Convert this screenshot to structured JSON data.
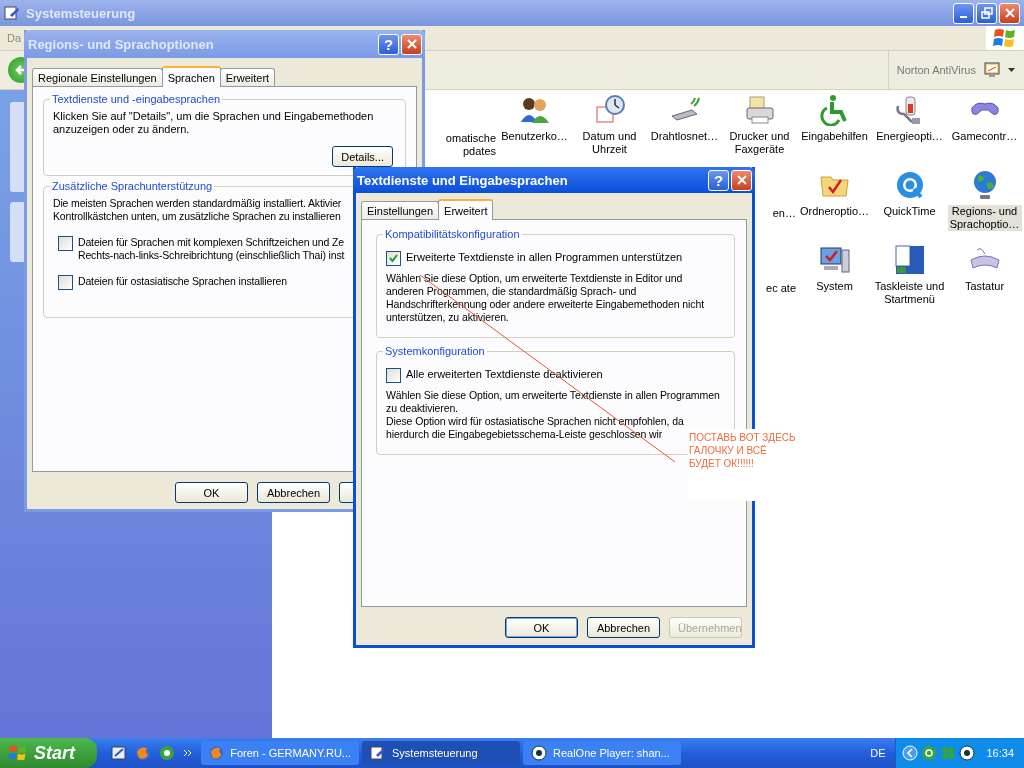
{
  "window": {
    "title": "Systemsteuerung",
    "menu": [
      "Da"
    ],
    "toolbar_label": "Norton AntiVirus"
  },
  "items": [
    [
      {
        "label": "omatische pdates",
        "kind": "cut",
        "selected": false
      },
      {
        "label": "Benutzerko…",
        "kind": "full",
        "selected": false
      },
      {
        "label": "Datum und Uhrzeit",
        "kind": "full",
        "selected": false
      },
      {
        "label": "Drahtlosnet…",
        "kind": "full",
        "selected": false
      },
      {
        "label": "Drucker und Faxgeräte",
        "kind": "full",
        "selected": false
      },
      {
        "label": "Eingabehilfen",
        "kind": "full",
        "selected": false
      },
      {
        "label": "Energieopti…",
        "kind": "full",
        "selected": false
      },
      {
        "label": "Gamecontr…",
        "kind": "full",
        "selected": false
      }
    ],
    [
      {
        "label": "en…",
        "kind": "cut",
        "selected": false
      },
      {
        "label": "Ordneroptio…",
        "kind": "full",
        "selected": false
      },
      {
        "label": "QuickTime",
        "kind": "full",
        "selected": false
      },
      {
        "label": "Regions- und Sprachoptio…",
        "kind": "full",
        "selected": true
      }
    ],
    [
      {
        "label": "ec ate",
        "kind": "cut",
        "selected": false
      },
      {
        "label": "System",
        "kind": "full",
        "selected": false
      },
      {
        "label": "Taskleiste und Startmenü",
        "kind": "full",
        "selected": false
      },
      {
        "label": "Tastatur",
        "kind": "full",
        "selected": false
      }
    ]
  ],
  "dialog_regions": {
    "title": "Regions- und Sprachoptionen",
    "help": "?",
    "tabs": [
      {
        "label": "Regionale Einstellungen",
        "selected": false
      },
      {
        "label": "Sprachen",
        "selected": true
      },
      {
        "label": "Erweitert",
        "selected": false
      }
    ],
    "group_1": {
      "title": "Textdienste und -eingabesprachen",
      "text": "Klicken Sie auf \"Details\", um die Sprachen und Eingabemethoden anzuzeigen oder zu ändern.",
      "button": "Details..."
    },
    "group_2": {
      "title": "Zusätzliche Sprachunterstützung",
      "lines": [
        "Die meisten Sprachen werden standardmäßig installiert. Aktivier",
        "Kontrollkästchen unten, um zusätzliche Sprachen zu installieren"
      ],
      "options": [
        {
          "lines": [
            "Dateien für Sprachen mit komplexen Schriftzeichen und Ze",
            "Rechts-nach-links-Schreibrichtung (einschließlich Thai) inst"
          ],
          "checked": false
        },
        {
          "lines": [
            "Dateien für ostasiatische Sprachen installieren"
          ],
          "checked": false
        }
      ]
    },
    "buttons": [
      "OK",
      "Abbrechen"
    ]
  },
  "dialog_text": {
    "title": "Textdienste und Eingabesprachen",
    "help": "?",
    "tabs": [
      {
        "label": "Einstellungen",
        "selected": false
      },
      {
        "label": "Erweitert",
        "selected": true
      }
    ],
    "groups": [
      {
        "title": "Kompatibilitätskonfiguration",
        "option": "Erweiterte Textdienste in allen Programmen unterstützen",
        "checked": true,
        "texts": [
          "Wählen Sie diese Option, um erweiterte Textdienste in Editor und anderen Programmen, die standardmäßig Sprach- und Handschrifterkennung oder andere erweiterte Eingabemethoden nicht unterstützen, zu aktivieren."
        ]
      },
      {
        "title": "Systemkonfiguration",
        "option": "Alle erweiterten Textdienste deaktivieren",
        "checked": false,
        "texts": [
          "Wählen Sie diese Option, um erweiterte Textdienste in allen Programmen zu deaktivieren.",
          "Diese Option wird für ostasiatische Sprachen nicht empfohlen, da hierdurch die Eingabegebietsschema-Leiste geschlossen wir"
        ]
      }
    ],
    "buttons": [
      {
        "label": "OK",
        "disabled": false
      },
      {
        "label": "Abbrechen",
        "disabled": false
      },
      {
        "label": "Übernehmen",
        "disabled": true
      }
    ]
  },
  "annotation": {
    "lines": [
      "ПОСТАВЬ ВОТ ЗДЕСЬ",
      "ГАЛОЧКУ И ВСЁ",
      "БУДЕТ ОК!!!!!!"
    ]
  },
  "taskbar": {
    "start": "Start",
    "tasks": [
      {
        "label": "Foren - GERMANY.RU...",
        "selected": false
      },
      {
        "label": "Systemsteuerung",
        "selected": true
      },
      {
        "label": "RealOne Player: shan...",
        "selected": false
      }
    ],
    "language": "DE",
    "clock": "16:34"
  }
}
